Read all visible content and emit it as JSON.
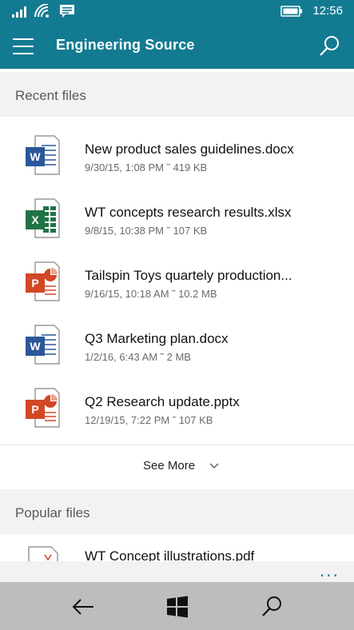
{
  "status_bar": {
    "time": "12:56",
    "icons": [
      "signal-icon",
      "wifi-icon",
      "message-icon",
      "battery-icon"
    ]
  },
  "header": {
    "title": "Engineering Source",
    "background": "#137b91"
  },
  "recent": {
    "label": "Recent files",
    "files": [
      {
        "name": "New product sales guidelines.docx",
        "meta": "9/30/15, 1:08 PM ˜ 419 KB",
        "type": "word"
      },
      {
        "name": "WT concepts research results.xlsx",
        "meta": "9/8/15, 10:38 PM ˜ 107 KB",
        "type": "excel"
      },
      {
        "name": "Tailspin Toys quartely production...",
        "meta": "9/16/15, 10:18 AM ˜ 10.2 MB",
        "type": "powerpoint"
      },
      {
        "name": "Q3 Marketing plan.docx",
        "meta": "1/2/16, 6:43 AM ˜ 2 MB",
        "type": "word"
      },
      {
        "name": "Q2 Research update.pptx",
        "meta": "12/19/15, 7:22 PM ˜ 107 KB",
        "type": "powerpoint"
      }
    ],
    "see_more": "See More"
  },
  "popular": {
    "label": "Popular files",
    "files": [
      {
        "name": "WT Concept illustrations.pdf",
        "type": "pdf"
      }
    ]
  },
  "app_bar": {
    "more": "..."
  },
  "colors": {
    "accent": "#137b91",
    "word": "#2b579a",
    "excel": "#217346",
    "powerpoint": "#d24726",
    "pdf": "#d33a2c"
  }
}
